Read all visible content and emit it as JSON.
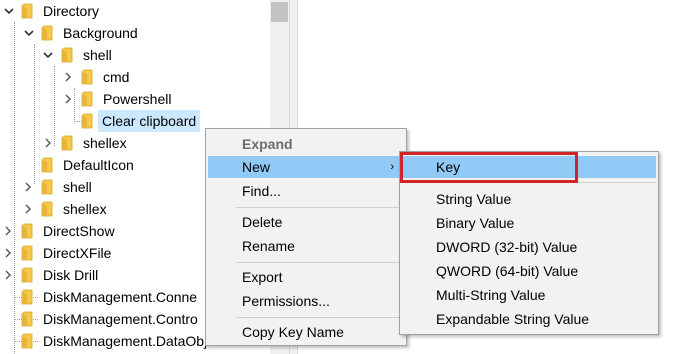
{
  "tree": {
    "items": [
      {
        "label": "Directory",
        "expanded": true
      },
      {
        "label": "Background",
        "expanded": true
      },
      {
        "label": "shell",
        "expanded": true
      },
      {
        "label": "cmd",
        "expanded": false
      },
      {
        "label": "Powershell",
        "expanded": false
      },
      {
        "label": "Clear clipboard",
        "selected": true
      },
      {
        "label": "shellex",
        "expanded": false
      },
      {
        "label": "DefaultIcon"
      },
      {
        "label": "shell",
        "expanded": false
      },
      {
        "label": "shellex",
        "expanded": false
      },
      {
        "label": "DirectShow",
        "expanded": false
      },
      {
        "label": "DirectXFile",
        "expanded": false
      },
      {
        "label": "Disk Drill",
        "expanded": false
      },
      {
        "label": "DiskManagement.Conne"
      },
      {
        "label": "DiskManagement.Contro"
      },
      {
        "label": "DiskManagement.DataObject"
      }
    ]
  },
  "context_menu": {
    "expand_label": "Expand",
    "new_label": "New",
    "find_label": "Find...",
    "delete_label": "Delete",
    "rename_label": "Rename",
    "export_label": "Export",
    "permissions_label": "Permissions...",
    "copy_key_name_label": "Copy Key Name"
  },
  "new_submenu": {
    "items": [
      "Key",
      "String Value",
      "Binary Value",
      "DWORD (32-bit) Value",
      "QWORD (64-bit) Value",
      "Multi-String Value",
      "Expandable String Value"
    ]
  },
  "colors": {
    "highlight": "#91c9f7",
    "selection": "#cce8ff",
    "annotation_box": "#d2232a",
    "folder": "#f6c94a"
  }
}
